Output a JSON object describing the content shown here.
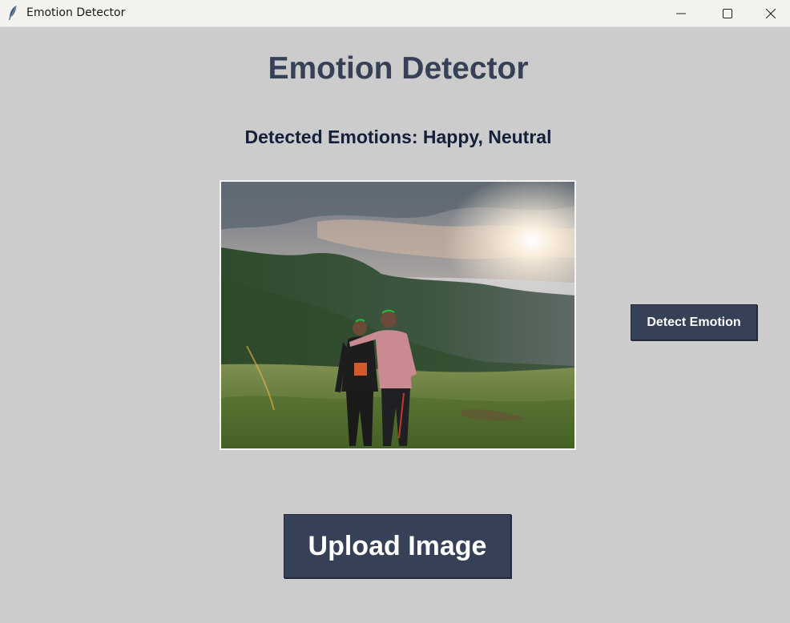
{
  "window": {
    "title": "Emotion Detector",
    "app_icon": "feather-icon",
    "controls": [
      "minimize-icon",
      "maximize-icon",
      "close-icon"
    ]
  },
  "main": {
    "heading": "Emotion Detector",
    "result_label": "Detected Emotions: Happy, Neutral",
    "image": {
      "content": "two-people-standing-on-grassy-hill-photo"
    },
    "detect_button": "Detect Emotion",
    "upload_button": "Upload Image"
  },
  "colors": {
    "background": "#cccccc",
    "titlebar": "#f3f2ef",
    "heading": "#364157",
    "result_text": "#141f3a",
    "button_bg": "#364157",
    "button_text": "#ffffff"
  }
}
